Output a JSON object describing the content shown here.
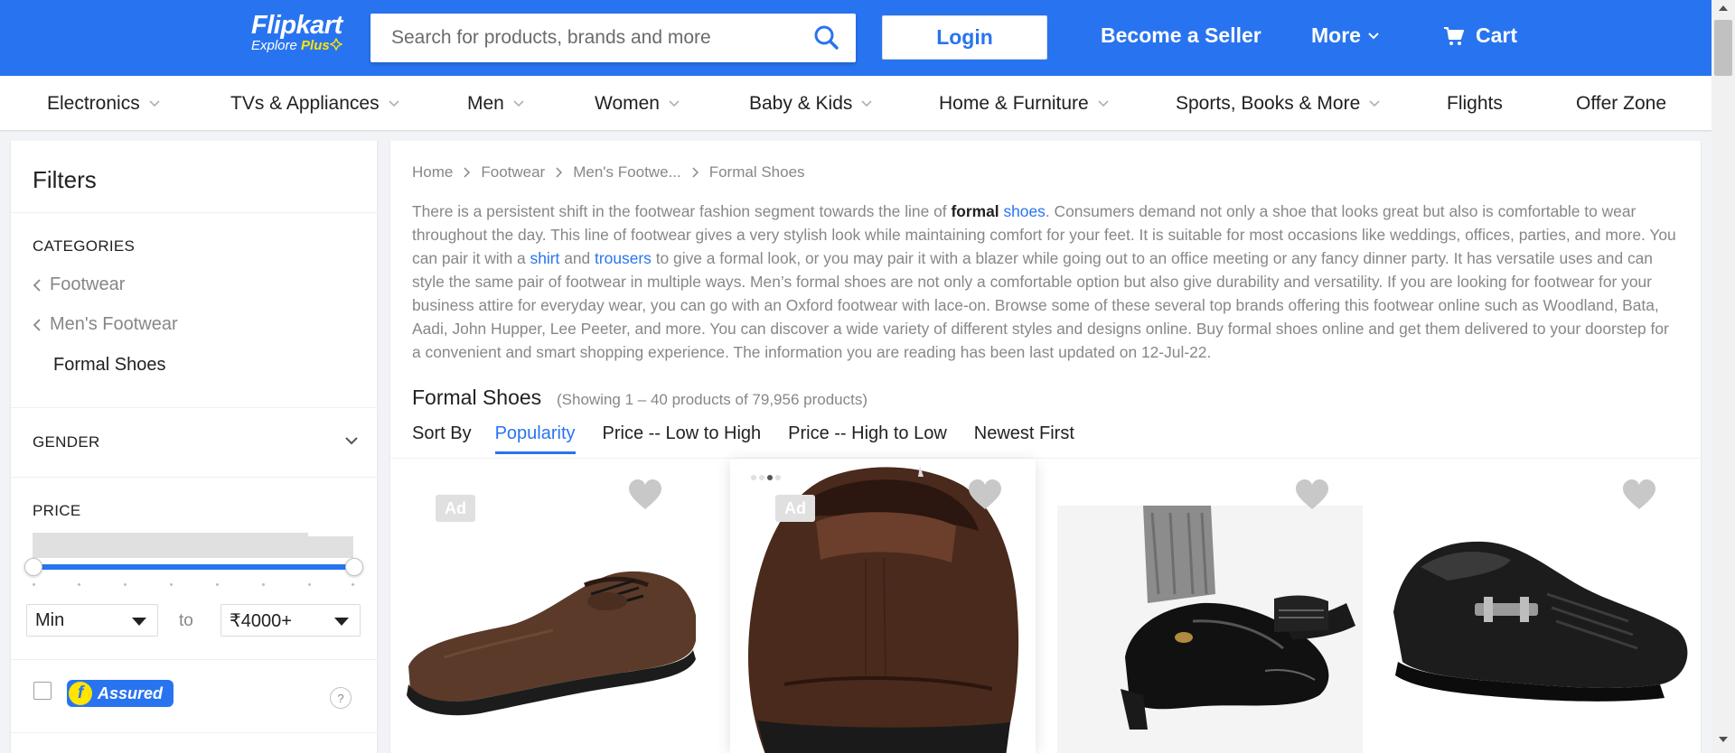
{
  "header": {
    "logo_text": "Flipkart",
    "logo_sub": "Explore",
    "logo_plus": "Plus",
    "search_placeholder": "Search for products, brands and more",
    "login_label": "Login",
    "become_seller_label": "Become a Seller",
    "more_label": "More",
    "cart_label": "Cart",
    "brand_color": "#2874f0"
  },
  "category_nav": [
    {
      "label": "Electronics",
      "has_dropdown": true
    },
    {
      "label": "TVs & Appliances",
      "has_dropdown": true
    },
    {
      "label": "Men",
      "has_dropdown": true
    },
    {
      "label": "Women",
      "has_dropdown": true
    },
    {
      "label": "Baby & Kids",
      "has_dropdown": true
    },
    {
      "label": "Home & Furniture",
      "has_dropdown": true
    },
    {
      "label": "Sports, Books & More",
      "has_dropdown": true
    },
    {
      "label": "Flights",
      "has_dropdown": false
    },
    {
      "label": "Offer Zone",
      "has_dropdown": false
    }
  ],
  "sidebar": {
    "title": "Filters",
    "categories_label": "CATEGORIES",
    "category_path": [
      "Footwear",
      "Men's Footwear"
    ],
    "current_category": "Formal Shoes",
    "gender_label": "GENDER",
    "price_label": "PRICE",
    "price_min_value": "Min",
    "price_to_label": "to",
    "price_max_value": "₹4000+",
    "assured_label": "Assured",
    "assured_checked": false,
    "help_label": "?"
  },
  "main": {
    "breadcrumb": [
      "Home",
      "Footwear",
      "Men's Footwe...",
      "Formal Shoes"
    ],
    "description": {
      "p1": "There is a persistent shift in the footwear fashion segment towards the line of ",
      "bold": "formal",
      "space": " ",
      "link_shoes": "shoes",
      "p2": ". Consumers demand not only a shoe that looks great but also is comfortable to wear throughout the day. This line of footwear gives a very stylish look while maintaining comfort for your feet. It is suitable for most occasions like weddings, offices, parties, and more. You can pair it with a ",
      "link_shirt": "shirt",
      "p3": " and ",
      "link_trousers": "trousers",
      "p4": " to give a formal look, or you may pair it with a blazer while going out to an office meeting or any fancy dinner party. It has versatile uses and can style the same pair of footwear in multiple ways. Men’s formal shoes are not only a comfortable option but also give durability and versatility. If you are looking for footwear for your business attire for everyday wear, you can go with an Oxford footwear with lace-on. Browse some of these several top brands offering this footwear online such as Woodland, Bata, Aadi, John Hupper, Lee Peeter, and more. You can discover a wide variety of different styles and designs online. Buy formal shoes online and get them delivered to your doorstep for a convenient and smart shopping experience. The information you are reading has been last updated on 12-Jul-22."
    },
    "result_title": "Formal Shoes",
    "result_count": "(Showing 1 – 40 products of 79,956 products)",
    "sort_label": "Sort By",
    "sort_options": [
      "Popularity",
      "Price -- Low to High",
      "Price -- High to Low",
      "Newest First"
    ],
    "active_sort": "Popularity",
    "products": [
      {
        "ad": true,
        "ad_label": "Ad",
        "image": "brown-oxford-shoe"
      },
      {
        "ad": true,
        "ad_label": "Ad",
        "image": "brown-leather-shoe-back"
      },
      {
        "ad": false,
        "image": "black-patent-shoe-worn"
      },
      {
        "ad": false,
        "image": "black-slip-on-buckle-shoe"
      }
    ]
  }
}
